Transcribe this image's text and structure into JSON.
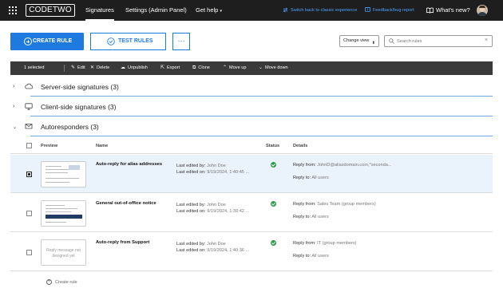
{
  "topbar": {
    "logo": "CODETWO",
    "tabs": [
      {
        "label": "Signatures",
        "active": true
      },
      {
        "label": "Settings (Admin Panel)",
        "active": false
      },
      {
        "label": "Get help",
        "active": false
      }
    ],
    "switch_link": "Switch back to classic experience",
    "feedback_link": "Feedback/bug report",
    "whats_new": "What's new?"
  },
  "actions": {
    "create_rule": "CREATE RULE",
    "test_rules": "TEST RULES",
    "more": "···",
    "change_view": "Change view",
    "search_placeholder": "Search rules"
  },
  "toolbar": {
    "selected": "1 selected",
    "items": [
      "Edit",
      "Delete",
      "Unpublish",
      "Export",
      "Clone",
      "Move up",
      "Move down"
    ]
  },
  "sections": [
    {
      "title": "Server-side signatures (3)",
      "expanded": false
    },
    {
      "title": "Client-side signatures (3)",
      "expanded": false
    },
    {
      "title": "Autoresponders (3)",
      "expanded": true
    }
  ],
  "table": {
    "headers": {
      "preview": "Preview",
      "name": "Name",
      "status": "Status",
      "details": "Details"
    },
    "rows": [
      {
        "name": "Auto-reply for alias addresses",
        "edited_by_label": "Last edited by:",
        "edited_by": "John Doe",
        "edited_on_label": "Last edited on:",
        "edited_on": "9/19/2024, 1:40:45 ...",
        "reply_from_label": "Reply from:",
        "reply_from": "JohnD@aliasdomain.com,*seconda...",
        "reply_to_label": "Reply to:",
        "reply_to": "All users",
        "selected": true,
        "preview_empty_text": ""
      },
      {
        "name": "General out-of-office notice",
        "edited_by_label": "Last edited by:",
        "edited_by": "John Doe",
        "edited_on_label": "Last edited on:",
        "edited_on": "9/19/2024, 1:39:42 ...",
        "reply_from_label": "Reply from:",
        "reply_from": "Sales Team (group members)",
        "reply_to_label": "Reply to:",
        "reply_to": "All users",
        "selected": false,
        "preview_empty_text": ""
      },
      {
        "name": "Auto-reply from Support",
        "edited_by_label": "Last edited by:",
        "edited_by": "John Doe",
        "edited_on_label": "Last edited on:",
        "edited_on": "9/19/2024, 1:40:36 ...",
        "reply_from_label": "Reply from:",
        "reply_from": "IT (group members)",
        "reply_to_label": "Reply to:",
        "reply_to": "All users",
        "selected": false,
        "preview_empty_text": "Reply message not designed yet"
      }
    ]
  },
  "footer": {
    "create_rule": "Create rule"
  },
  "colors": {
    "accent": "#1f7ae0",
    "topbar": "#1e1e1e",
    "toolbar": "#3a3a3a",
    "status_ok": "#2e9e4a",
    "selected_row": "#eaf2fb"
  }
}
